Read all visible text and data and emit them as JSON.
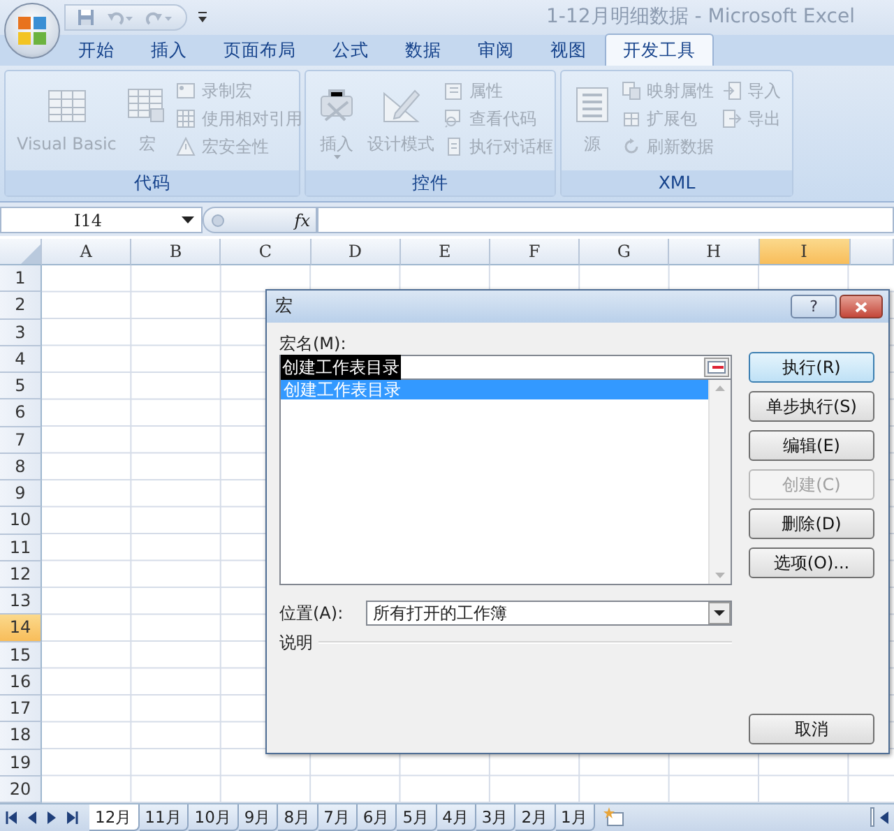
{
  "window": {
    "title": "1-12月明细数据 - Microsoft Excel"
  },
  "ribbon_tabs": [
    {
      "label": "开始",
      "selected": false
    },
    {
      "label": "插入",
      "selected": false
    },
    {
      "label": "页面布局",
      "selected": false
    },
    {
      "label": "公式",
      "selected": false
    },
    {
      "label": "数据",
      "selected": false
    },
    {
      "label": "审阅",
      "selected": false
    },
    {
      "label": "视图",
      "selected": false
    },
    {
      "label": "开发工具",
      "selected": true
    }
  ],
  "ribbon_groups": [
    {
      "label": "代码",
      "disabled": true,
      "large_buttons": [
        {
          "label": "Visual Basic",
          "dropdown": false
        },
        {
          "label": "宏",
          "dropdown": false
        }
      ],
      "small_columns": [
        [
          {
            "label": "录制宏"
          },
          {
            "label": "使用相对引用"
          },
          {
            "label": "宏安全性"
          }
        ]
      ]
    },
    {
      "label": "控件",
      "disabled": true,
      "large_buttons": [
        {
          "label": "插入",
          "dropdown": true
        },
        {
          "label": "设计模式",
          "dropdown": false
        }
      ],
      "small_columns": [
        [
          {
            "label": "属性"
          },
          {
            "label": "查看代码"
          },
          {
            "label": "执行对话框"
          }
        ]
      ]
    },
    {
      "label": "XML",
      "disabled": true,
      "large_buttons": [
        {
          "label": "源",
          "dropdown": false
        }
      ],
      "small_columns": [
        [
          {
            "label": "映射属性"
          },
          {
            "label": "扩展包"
          },
          {
            "label": "刷新数据"
          }
        ],
        [
          {
            "label": "导入"
          },
          {
            "label": "导出"
          }
        ]
      ]
    }
  ],
  "formula_bar": {
    "name_box": "I14",
    "function_label": "fx"
  },
  "sheet": {
    "columns": [
      {
        "label": "A",
        "selected": false
      },
      {
        "label": "B",
        "selected": false
      },
      {
        "label": "C",
        "selected": false
      },
      {
        "label": "D",
        "selected": false
      },
      {
        "label": "E",
        "selected": false
      },
      {
        "label": "F",
        "selected": false
      },
      {
        "label": "G",
        "selected": false
      },
      {
        "label": "H",
        "selected": false
      },
      {
        "label": "I",
        "selected": true
      }
    ],
    "rows": [
      {
        "label": "1",
        "selected": false
      },
      {
        "label": "2",
        "selected": false
      },
      {
        "label": "3",
        "selected": false
      },
      {
        "label": "4",
        "selected": false
      },
      {
        "label": "5",
        "selected": false
      },
      {
        "label": "6",
        "selected": false
      },
      {
        "label": "7",
        "selected": false
      },
      {
        "label": "8",
        "selected": false
      },
      {
        "label": "9",
        "selected": false
      },
      {
        "label": "10",
        "selected": false
      },
      {
        "label": "11",
        "selected": false
      },
      {
        "label": "12",
        "selected": false
      },
      {
        "label": "13",
        "selected": false
      },
      {
        "label": "14",
        "selected": true
      },
      {
        "label": "15",
        "selected": false
      },
      {
        "label": "16",
        "selected": false
      },
      {
        "label": "17",
        "selected": false
      },
      {
        "label": "18",
        "selected": false
      },
      {
        "label": "19",
        "selected": false
      },
      {
        "label": "20",
        "selected": false
      }
    ]
  },
  "sheet_tabs": [
    {
      "label": "12月",
      "selected": true
    },
    {
      "label": "11月",
      "selected": false
    },
    {
      "label": "10月",
      "selected": false
    },
    {
      "label": "9月",
      "selected": false
    },
    {
      "label": "8月",
      "selected": false
    },
    {
      "label": "7月",
      "selected": false
    },
    {
      "label": "6月",
      "selected": false
    },
    {
      "label": "5月",
      "selected": false
    },
    {
      "label": "4月",
      "selected": false
    },
    {
      "label": "3月",
      "selected": false
    },
    {
      "label": "2月",
      "selected": false
    },
    {
      "label": "1月",
      "selected": false
    }
  ],
  "dialog": {
    "title": "宏",
    "help_button": "?",
    "macro_name_label": "宏名(M):",
    "macro_name": {
      "value": "创建工作表目录",
      "text_selected": true
    },
    "macros": [
      {
        "label": "创建工作表目录",
        "selected": true
      }
    ],
    "location_label": "位置(A):",
    "location": "所有打开的工作簿",
    "description_label": "说明",
    "buttons": [
      {
        "label": "执行(R)",
        "kind": "default",
        "disabled": false
      },
      {
        "label": "单步执行(S)",
        "kind": "normal",
        "disabled": false
      },
      {
        "label": "编辑(E)",
        "kind": "normal",
        "disabled": false
      },
      {
        "label": "创建(C)",
        "kind": "normal",
        "disabled": true
      },
      {
        "label": "删除(D)",
        "kind": "normal",
        "disabled": false
      },
      {
        "label": "选项(O)...",
        "kind": "normal",
        "disabled": false
      },
      {
        "label": "取消",
        "kind": "cancel",
        "disabled": false
      }
    ]
  }
}
